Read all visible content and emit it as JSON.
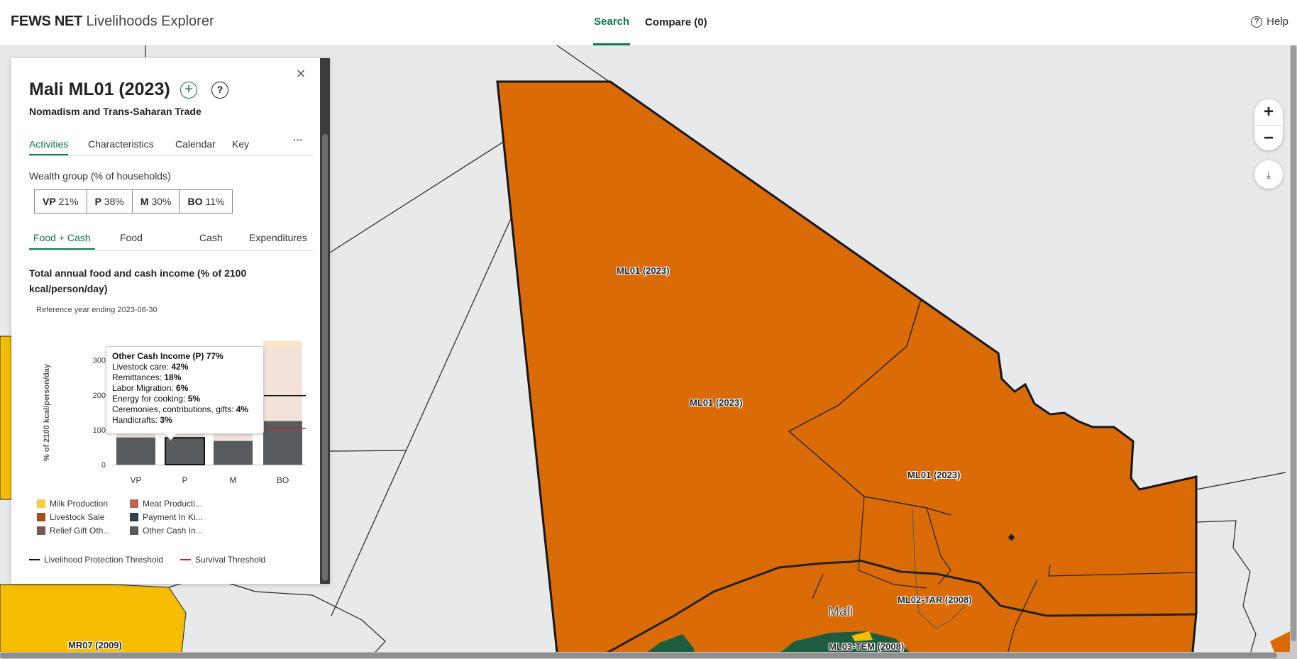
{
  "header": {
    "brand_bold": "FEWS NET",
    "brand_rest": "Livelihoods Explorer",
    "nav": [
      {
        "label": "Search",
        "active": true
      },
      {
        "label": "Compare (0)",
        "active": false
      }
    ],
    "help_label": "Help"
  },
  "map": {
    "zone_color": "#db6b07",
    "neighbor_color": "#f5be00",
    "green_color": "#1d5c3e",
    "labels": [
      "ML01 (2023)",
      "ML01 (2023)",
      "ML01 (2023)",
      "ML02-TAR (2008)",
      "ML03-TEM (2008)",
      "MR07 (2009)"
    ],
    "country_label": "Mali",
    "controls": {
      "zoom_in": "+",
      "zoom_out": "−",
      "download_icon": "download-icon"
    }
  },
  "panel": {
    "title": "Mali ML01 (2023)",
    "subtitle": "Nomadism and Trans-Saharan Trade",
    "close_icon": "close-icon",
    "add_icon": "plus-circle-icon",
    "info_icon": "question-circle-icon",
    "tabs": [
      {
        "label": "Activities",
        "active": true
      },
      {
        "label": "Characteristics",
        "active": false
      },
      {
        "label": "Calendar",
        "active": false
      },
      {
        "label": "Key",
        "active": false
      }
    ],
    "tabs_more": "···",
    "wealth_group_label": "Wealth group (% of households)",
    "wealth_groups": [
      {
        "code": "VP",
        "pct": "21%"
      },
      {
        "code": "P",
        "pct": "38%"
      },
      {
        "code": "M",
        "pct": "30%"
      },
      {
        "code": "BO",
        "pct": "11%"
      }
    ],
    "income_tabs": [
      {
        "label": "Food + Cash",
        "active": true
      },
      {
        "label": "Food",
        "active": false
      },
      {
        "label": "Cash",
        "active": false
      },
      {
        "label": "Expenditures",
        "active": false
      }
    ],
    "chart_title": "Total annual food and cash income (% of 2100 kcal/person/day)",
    "reference_year": "Reference year ending 2023-06-30",
    "tooltip": {
      "title": "Other Cash Income (P) 77%",
      "rows": [
        {
          "label": "Livestock care: ",
          "value": "42%"
        },
        {
          "label": "Remittances: ",
          "value": "18%"
        },
        {
          "label": "Labor Migration: ",
          "value": "6%"
        },
        {
          "label": "Energy for cooking: ",
          "value": "5%"
        },
        {
          "label": "Ceremonies, contributions, gifts: ",
          "value": "4%"
        },
        {
          "label": "Handicrafts: ",
          "value": "3%"
        }
      ]
    },
    "legend": [
      {
        "label": "Milk Production",
        "color": "#f7cf3d"
      },
      {
        "label": "Meat Producti...",
        "color": "#b8694e"
      },
      {
        "label": "Livestock Sale",
        "color": "#a84a1e"
      },
      {
        "label": "Payment In Ki...",
        "color": "#333f4a"
      },
      {
        "label": "Relief Gift Oth...",
        "color": "#7a5656"
      },
      {
        "label": "Other Cash In...",
        "color": "#575b5e"
      }
    ],
    "thresholds": [
      {
        "label": "Livelihood Protection Threshold",
        "color": "#111111"
      },
      {
        "label": "Survival Threshold",
        "color": "#c41e2a"
      }
    ]
  },
  "chart_data": {
    "type": "bar",
    "ylabel": "% of 2100 kcal/person/day",
    "ylim": [
      0,
      340
    ],
    "yticks": [
      0,
      100,
      200,
      300
    ],
    "categories": [
      "VP",
      "P",
      "M",
      "BO"
    ],
    "series": [
      {
        "name": "Other Cash In...",
        "values": [
          78,
          77,
          68,
          125
        ]
      }
    ],
    "background_totals": [
      115,
      120,
      240,
      355
    ],
    "livelihood_protection_threshold": 198,
    "survival_threshold": 104,
    "highlighted_category": "P"
  }
}
